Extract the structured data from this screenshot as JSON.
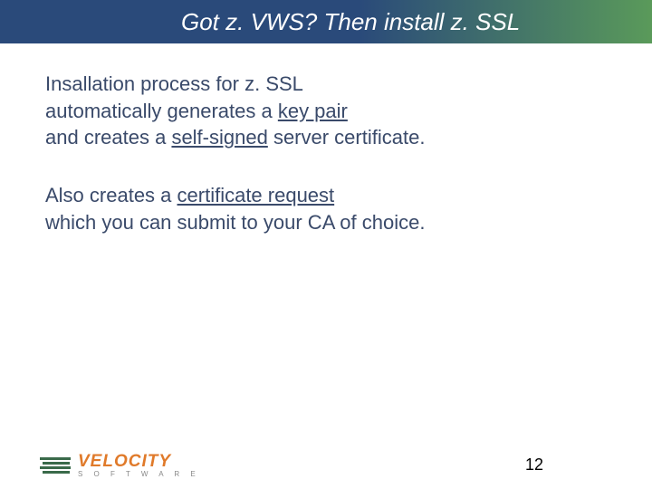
{
  "header": {
    "title": "Got z. VWS? Then install z. SSL"
  },
  "body": {
    "p1_pre": "Insallation process for z. SSL\nautomatically generates a ",
    "p1_u1": "key pair",
    "p1_mid": "\nand creates a ",
    "p1_u2": "self-signed",
    "p1_post": " server certificate.",
    "p2_pre": "Also creates a ",
    "p2_u1": "certificate request",
    "p2_post": "\nwhich you can submit to your CA of choice."
  },
  "footer": {
    "logo_top": "VELOCITY",
    "logo_bottom": "S O F T W A R E",
    "page_number": "12"
  }
}
